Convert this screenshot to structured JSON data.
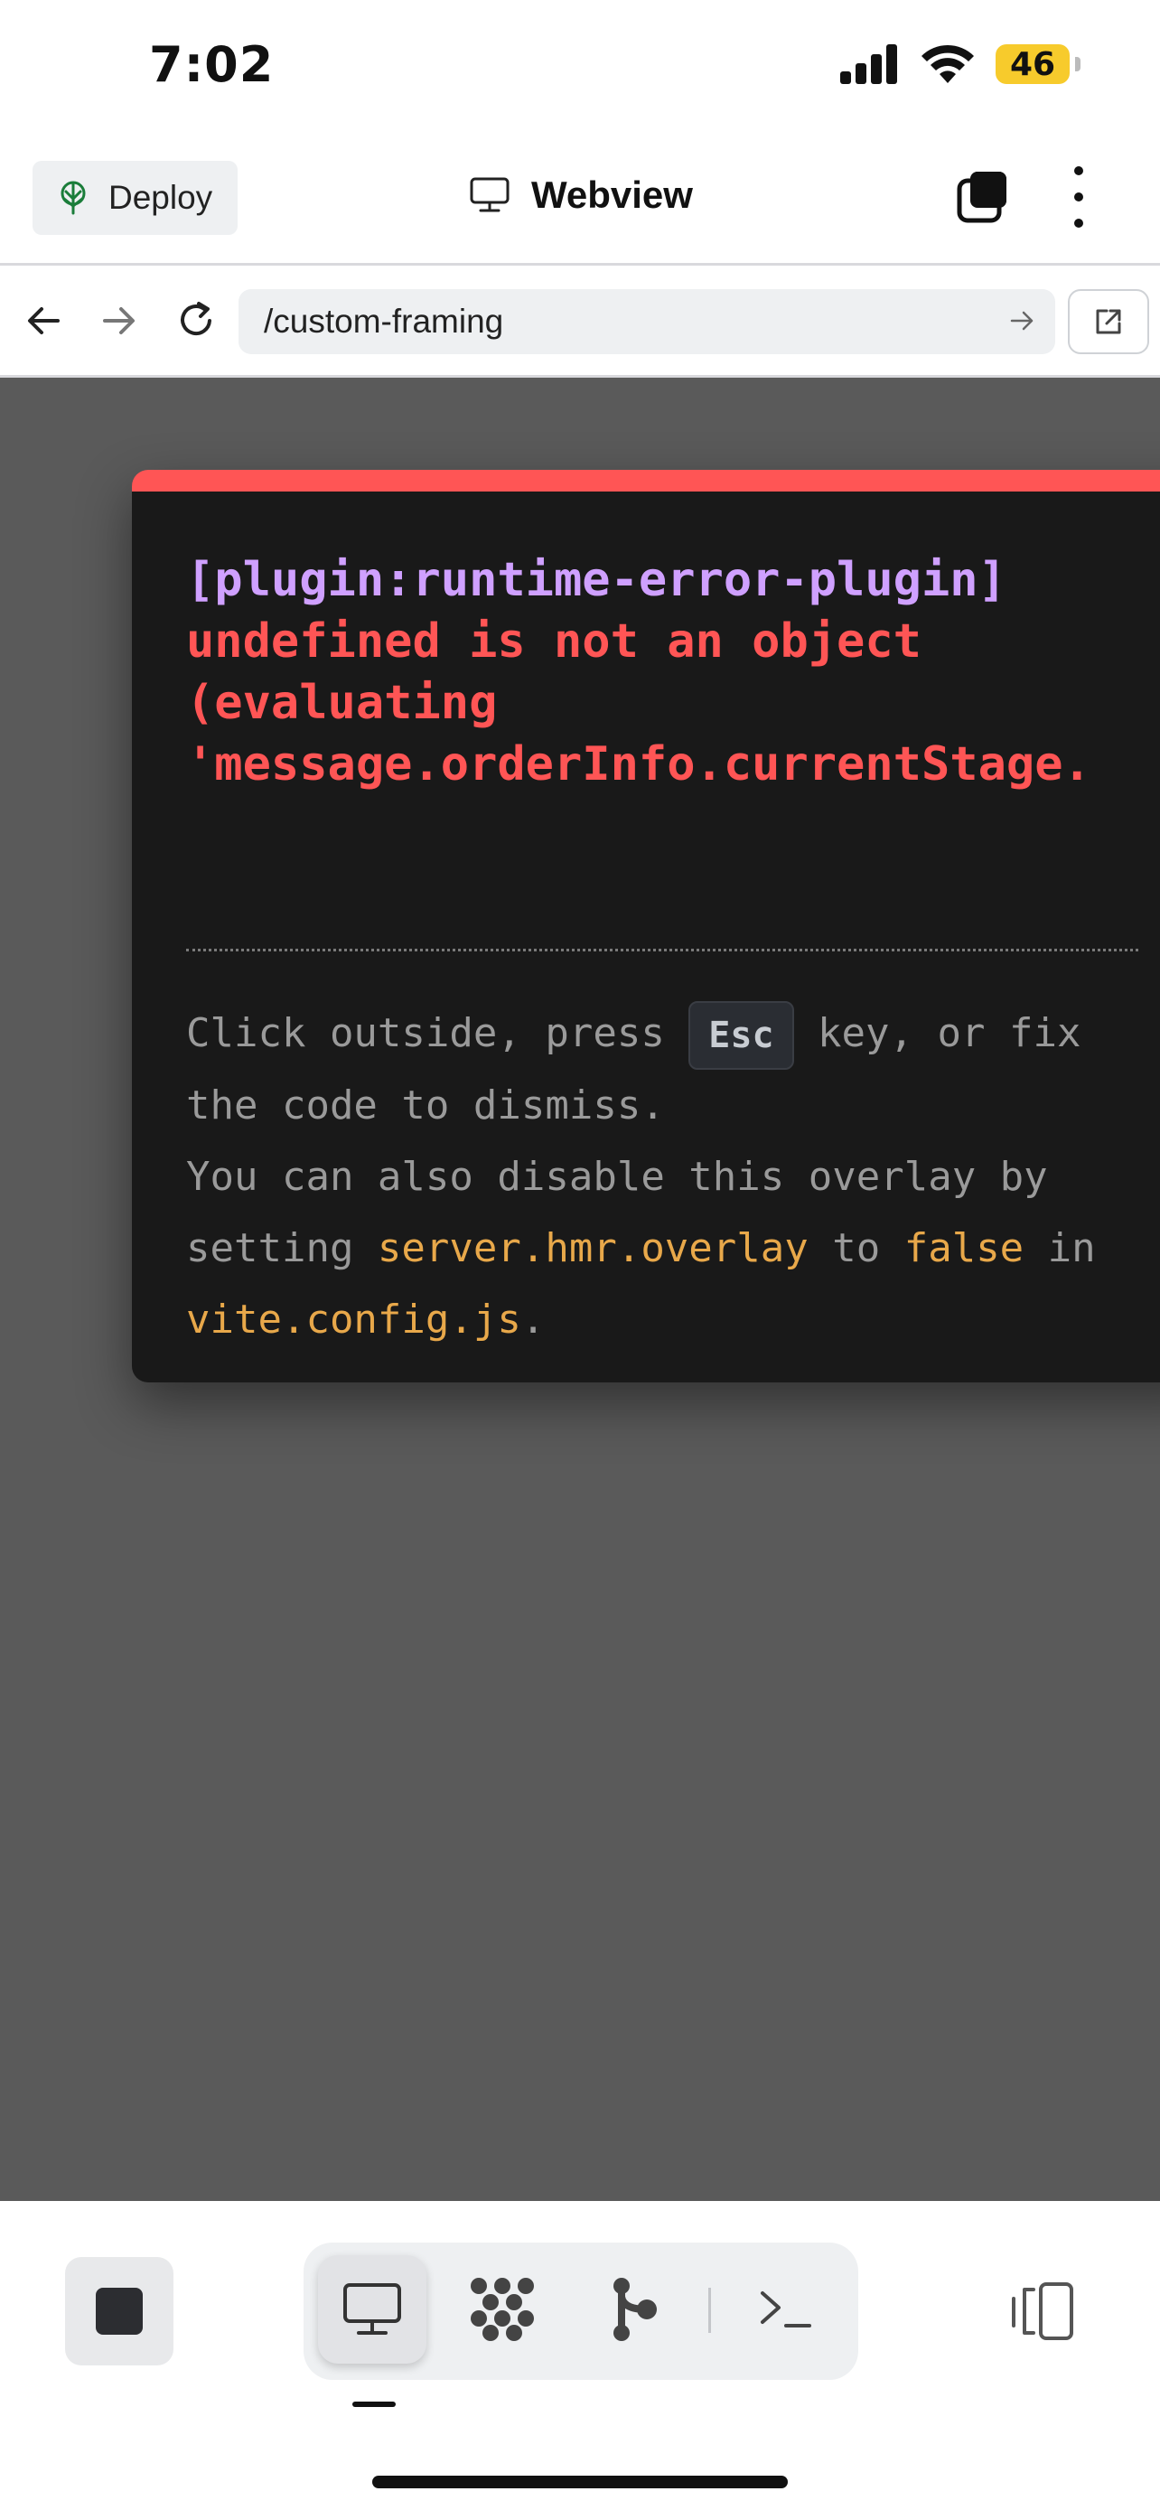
{
  "status_bar": {
    "time": "7:02",
    "battery": "46"
  },
  "header": {
    "deploy_label": "Deploy",
    "title": "Webview"
  },
  "url_bar": {
    "url": "/custom-framing"
  },
  "error_overlay": {
    "plugin": "[plugin:runtime-error-plugin]",
    "message_lines": [
      "undefined is not an object",
      "(evaluating",
      "'message.orderInfo.currentStage."
    ],
    "tip_part1": "Click outside, press ",
    "esc_key": "Esc",
    "tip_part2": " key, or fix",
    "tip_part3": "the code to dismiss.",
    "tip_part4": "You can also disable this overlay by",
    "tip_part5": "setting ",
    "code_config_key": "server.hmr.overlay",
    "tip_part6": " to ",
    "code_false": "false",
    "tip_part7": " in",
    "code_file": "vite.config.js",
    "tip_part8": "."
  },
  "colors": {
    "overlay_top": "#ff5555",
    "plugin_text": "#cfa0ff",
    "error_text": "#ff5555",
    "code_text": "#e8a84a",
    "battery": "#f7cb2c"
  },
  "icons": {
    "deploy": "deploy-icon",
    "webview": "monitor-icon",
    "tabs": "tabs-icon",
    "more": "more-vertical-icon",
    "back": "arrow-left-icon",
    "forward": "arrow-right-icon",
    "reload": "reload-icon",
    "open_external": "external-link-icon"
  }
}
